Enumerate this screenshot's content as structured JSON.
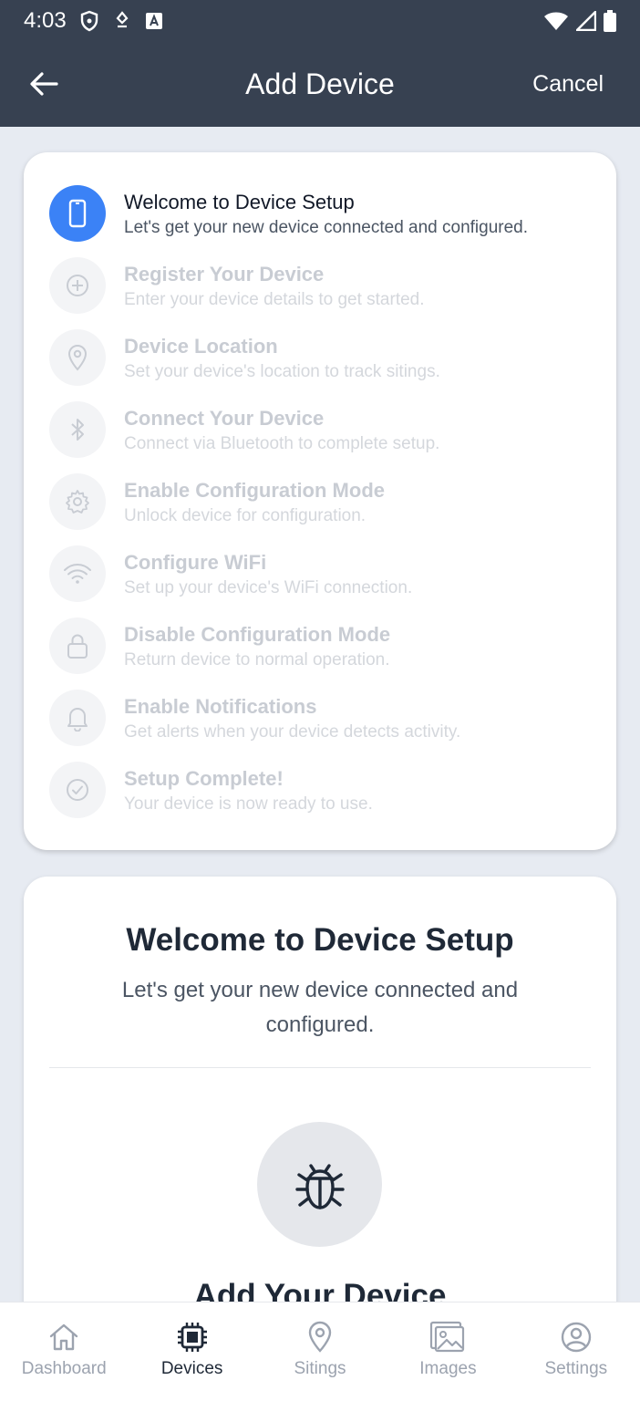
{
  "status_bar": {
    "time": "4:03"
  },
  "header": {
    "title": "Add Device",
    "cancel_label": "Cancel"
  },
  "steps": [
    {
      "title": "Welcome to Device Setup",
      "desc": "Let's get your new device connected and configured.",
      "icon": "phone-icon",
      "active": true
    },
    {
      "title": "Register Your Device",
      "desc": "Enter your device details to get started.",
      "icon": "plus-circle-icon",
      "active": false
    },
    {
      "title": "Device Location",
      "desc": "Set your device's location to track sitings.",
      "icon": "location-pin-icon",
      "active": false
    },
    {
      "title": "Connect Your Device",
      "desc": "Connect via Bluetooth to complete setup.",
      "icon": "bluetooth-icon",
      "active": false
    },
    {
      "title": "Enable Configuration Mode",
      "desc": "Unlock device for configuration.",
      "icon": "gear-icon",
      "active": false
    },
    {
      "title": "Configure WiFi",
      "desc": "Set up your device's WiFi connection.",
      "icon": "wifi-icon",
      "active": false
    },
    {
      "title": "Disable Configuration Mode",
      "desc": "Return device to normal operation.",
      "icon": "lock-icon",
      "active": false
    },
    {
      "title": "Enable Notifications",
      "desc": "Get alerts when your device detects activity.",
      "icon": "bell-icon",
      "active": false
    },
    {
      "title": "Setup Complete!",
      "desc": "Your device is now ready to use.",
      "icon": "check-circle-icon",
      "active": false
    }
  ],
  "welcome": {
    "title": "Welcome to Device Setup",
    "desc": "Let's get your new device connected and configured.",
    "next_heading": "Add Your Device"
  },
  "bottom_nav": [
    {
      "label": "Dashboard",
      "icon": "home-icon",
      "active": false
    },
    {
      "label": "Devices",
      "icon": "chip-icon",
      "active": true
    },
    {
      "label": "Sitings",
      "icon": "location-pin-icon",
      "active": false
    },
    {
      "label": "Images",
      "icon": "images-icon",
      "active": false
    },
    {
      "label": "Settings",
      "icon": "user-circle-icon",
      "active": false
    }
  ],
  "colors": {
    "header_bg": "#374151",
    "accent": "#3b82f6",
    "page_bg": "#e7ebf2"
  }
}
